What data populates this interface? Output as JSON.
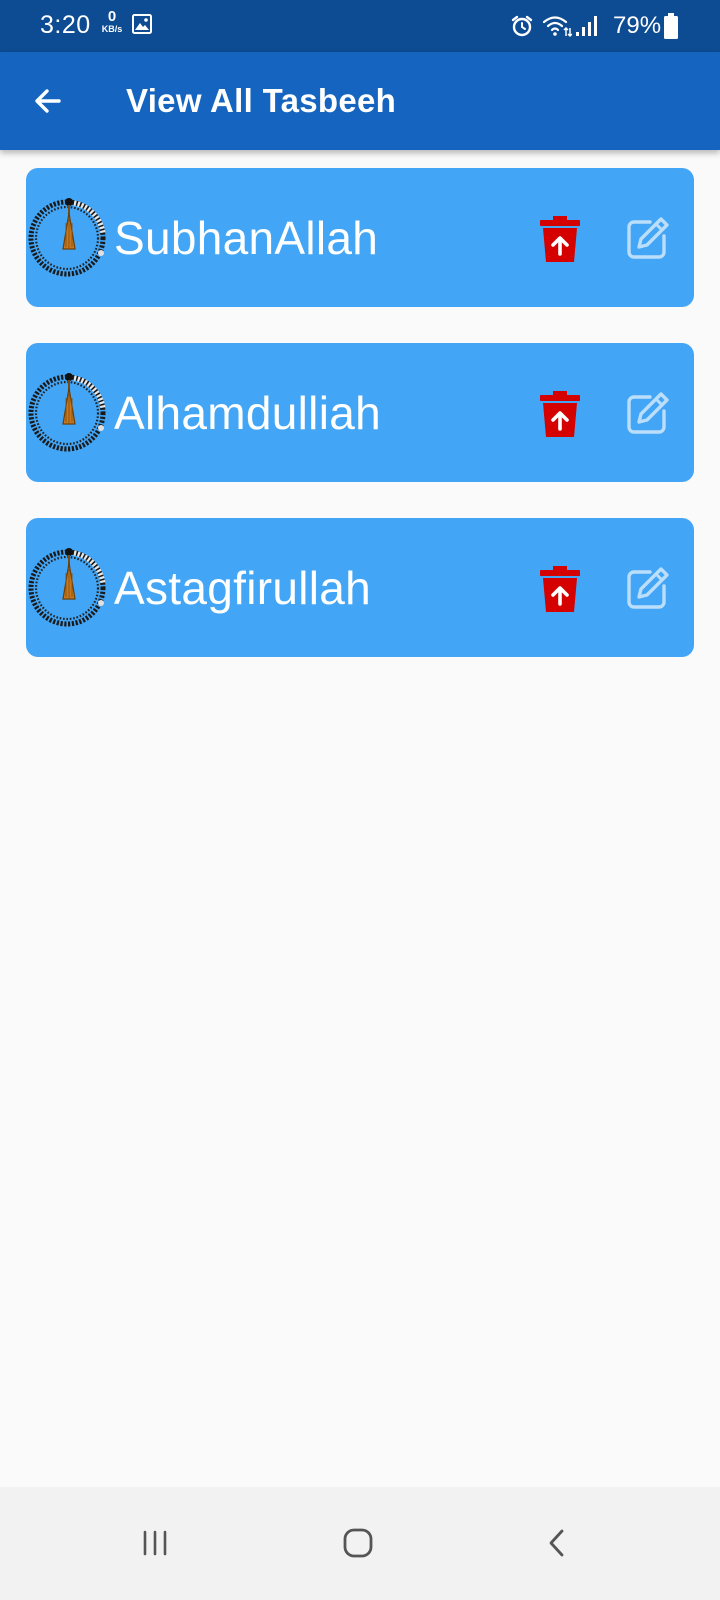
{
  "status_bar": {
    "time": "3:20",
    "network_speed_value": "0",
    "network_speed_unit": "KB/s",
    "battery": "79%",
    "icons": [
      "gallery-icon",
      "alarm-icon",
      "wifi-icon",
      "signal-icon",
      "battery-icon"
    ]
  },
  "app_bar": {
    "title": "View All Tasbeeh",
    "back_icon": "arrow-left-icon",
    "background": "#1565c0"
  },
  "tasbeeh_list": [
    {
      "name": "SubhanAllah"
    },
    {
      "name": "Alhamdulliah"
    },
    {
      "name": "Astagfirullah"
    }
  ],
  "card_actions": {
    "delete_icon": "delete-upload-icon",
    "edit_icon": "edit-pencil-icon"
  },
  "colors": {
    "status_bar": "#0d4c92",
    "app_bar": "#1565c0",
    "card": "#42a5f5",
    "delete": "#d50000",
    "edit": "#bbdefb",
    "background": "#fafafa"
  },
  "nav_bar": {
    "icons": [
      "recent-apps-icon",
      "home-icon",
      "back-icon"
    ]
  }
}
